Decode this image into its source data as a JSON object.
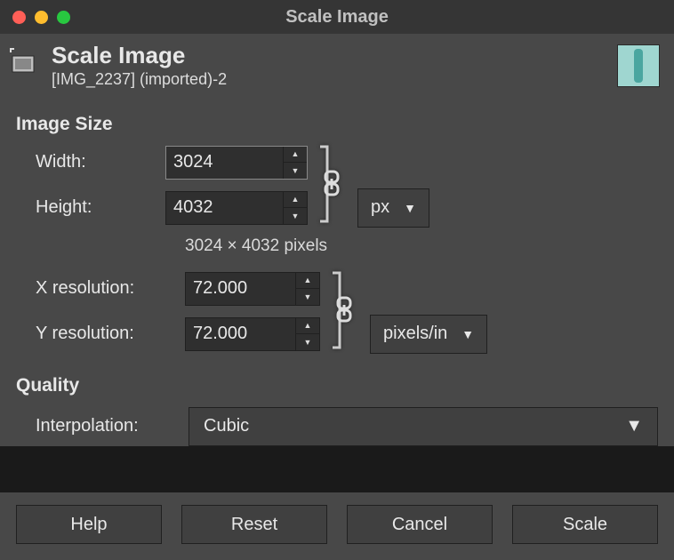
{
  "window": {
    "title": "Scale Image"
  },
  "header": {
    "title": "Scale Image",
    "subtitle": "[IMG_2237] (imported)-2"
  },
  "sections": {
    "image_size": {
      "title": "Image Size",
      "width_label": "Width:",
      "height_label": "Height:",
      "width_value": "3024",
      "height_value": "4032",
      "unit_label": "px",
      "readout": "3024 × 4032 pixels"
    },
    "resolution": {
      "x_label": "X resolution:",
      "y_label": "Y resolution:",
      "x_value": "72.000",
      "y_value": "72.000",
      "unit_label": "pixels/in"
    },
    "quality": {
      "title": "Quality",
      "interp_label": "Interpolation:",
      "interp_value": "Cubic"
    }
  },
  "buttons": {
    "help": "Help",
    "reset": "Reset",
    "cancel": "Cancel",
    "scale": "Scale"
  }
}
